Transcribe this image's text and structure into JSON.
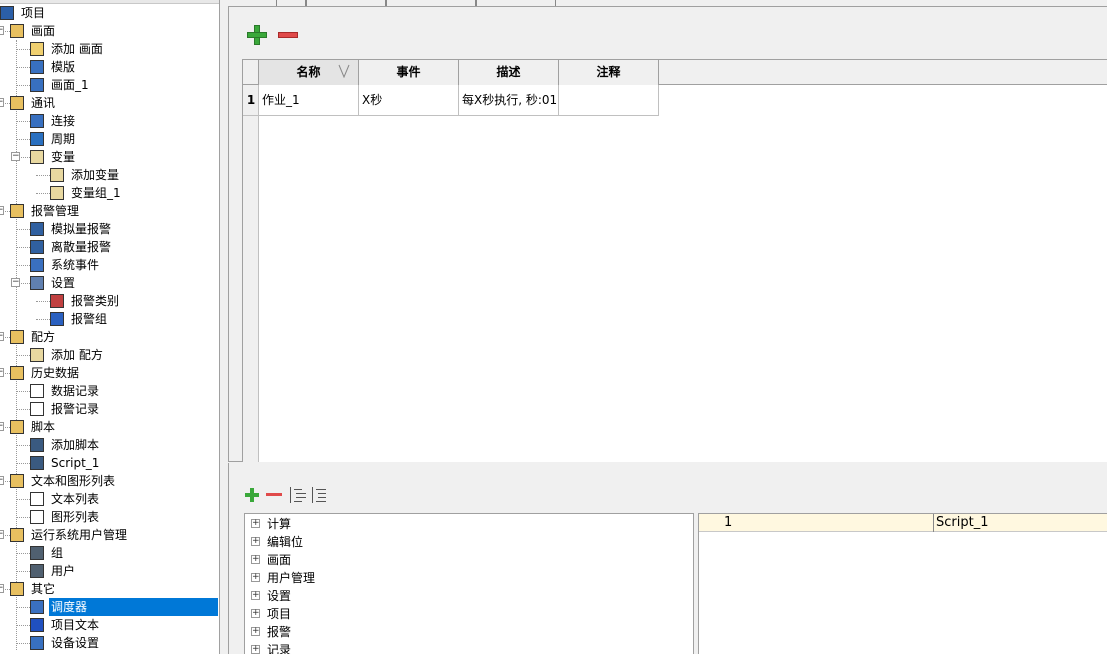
{
  "colors": {
    "selection": "#0078d7",
    "add_green": "#3aa83a",
    "remove_red": "#e04a4a",
    "script_row_bg": "#fff8e0"
  },
  "tree": {
    "items": [
      {
        "label": "项目",
        "icon": "project-icon"
      },
      {
        "label": "画面",
        "icon": "screens-folder-icon"
      },
      {
        "label": "添加 画面",
        "icon": "add-screen-icon"
      },
      {
        "label": "模版",
        "icon": "template-icon"
      },
      {
        "label": "画面_1",
        "icon": "screen-icon"
      },
      {
        "label": "通讯",
        "icon": "communication-folder-icon"
      },
      {
        "label": "连接",
        "icon": "connection-icon"
      },
      {
        "label": "周期",
        "icon": "cycle-icon"
      },
      {
        "label": "变量",
        "icon": "tags-icon"
      },
      {
        "label": "添加变量",
        "icon": "add-tag-icon"
      },
      {
        "label": "变量组_1",
        "icon": "tag-group-icon"
      },
      {
        "label": "报警管理",
        "icon": "alarm-folder-icon"
      },
      {
        "label": "模拟量报警",
        "icon": "analog-alarm-icon"
      },
      {
        "label": "离散量报警",
        "icon": "discrete-alarm-icon"
      },
      {
        "label": "系统事件",
        "icon": "system-event-icon"
      },
      {
        "label": "设置",
        "icon": "settings-icon"
      },
      {
        "label": "报警类别",
        "icon": "alarm-class-icon"
      },
      {
        "label": "报警组",
        "icon": "alarm-group-icon"
      },
      {
        "label": "配方",
        "icon": "recipe-folder-icon"
      },
      {
        "label": "添加 配方",
        "icon": "add-recipe-icon"
      },
      {
        "label": "历史数据",
        "icon": "history-folder-icon"
      },
      {
        "label": "数据记录",
        "icon": "data-log-icon"
      },
      {
        "label": "报警记录",
        "icon": "alarm-log-icon"
      },
      {
        "label": "脚本",
        "icon": "scripts-folder-icon"
      },
      {
        "label": "添加脚本",
        "icon": "add-script-icon"
      },
      {
        "label": "Script_1",
        "icon": "script-icon"
      },
      {
        "label": "文本和图形列表",
        "icon": "lists-folder-icon"
      },
      {
        "label": "文本列表",
        "icon": "text-list-icon"
      },
      {
        "label": "图形列表",
        "icon": "graphic-list-icon"
      },
      {
        "label": "运行系统用户管理",
        "icon": "users-folder-icon"
      },
      {
        "label": "组",
        "icon": "group-icon"
      },
      {
        "label": "用户",
        "icon": "user-icon"
      },
      {
        "label": "其它",
        "icon": "other-folder-icon"
      },
      {
        "label": "调度器",
        "icon": "scheduler-icon"
      },
      {
        "label": "项目文本",
        "icon": "project-text-icon"
      },
      {
        "label": "设备设置",
        "icon": "device-settings-icon"
      }
    ]
  },
  "scheduler_grid": {
    "headers": [
      "名称",
      "事件",
      "描述",
      "注释"
    ],
    "rows": [
      {
        "num": "1",
        "name": "作业_1",
        "event": "X秒",
        "description": "每X秒执行, 秒:01",
        "comment": ""
      }
    ]
  },
  "function_tree": {
    "items": [
      "计算",
      "编辑位",
      "画面",
      "用户管理",
      "设置",
      "项目",
      "报警",
      "记录"
    ]
  },
  "function_list": {
    "rows": [
      {
        "index": "1",
        "function": "Script_1"
      }
    ]
  }
}
